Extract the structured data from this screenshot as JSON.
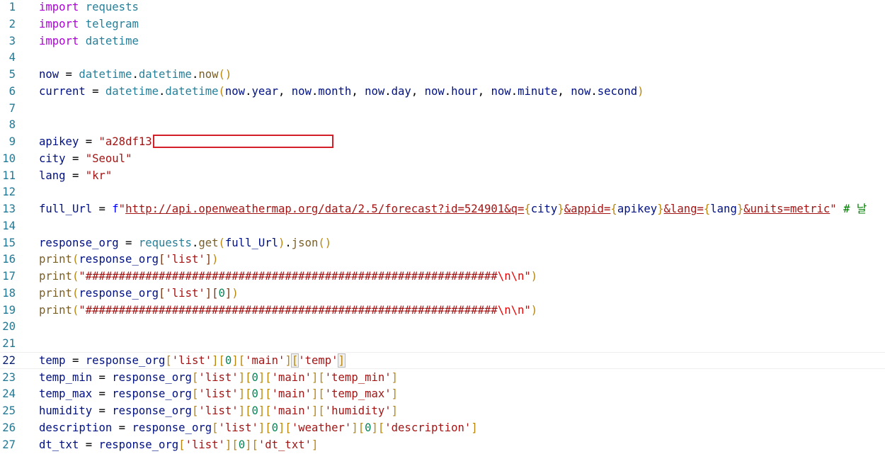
{
  "editor": {
    "current_line": 22,
    "lines": [
      {
        "n": "1",
        "tokens": [
          {
            "t": "import",
            "c": "kw"
          },
          {
            "t": " ",
            "c": "op"
          },
          {
            "t": "requests",
            "c": "mod"
          }
        ]
      },
      {
        "n": "2",
        "tokens": [
          {
            "t": "import",
            "c": "kw"
          },
          {
            "t": " ",
            "c": "op"
          },
          {
            "t": "telegram",
            "c": "mod"
          }
        ]
      },
      {
        "n": "3",
        "tokens": [
          {
            "t": "import",
            "c": "kw"
          },
          {
            "t": " ",
            "c": "op"
          },
          {
            "t": "datetime",
            "c": "mod"
          }
        ]
      },
      {
        "n": "4",
        "tokens": []
      },
      {
        "n": "5",
        "tokens": [
          {
            "t": "now",
            "c": "var"
          },
          {
            "t": " = ",
            "c": "op"
          },
          {
            "t": "datetime",
            "c": "mod"
          },
          {
            "t": ".",
            "c": "op"
          },
          {
            "t": "datetime",
            "c": "mod"
          },
          {
            "t": ".",
            "c": "op"
          },
          {
            "t": "now",
            "c": "fn"
          },
          {
            "t": "()",
            "c": "brgold"
          }
        ]
      },
      {
        "n": "6",
        "tokens": [
          {
            "t": "current",
            "c": "var"
          },
          {
            "t": " = ",
            "c": "op"
          },
          {
            "t": "datetime",
            "c": "mod"
          },
          {
            "t": ".",
            "c": "op"
          },
          {
            "t": "datetime",
            "c": "mod"
          },
          {
            "t": "(",
            "c": "brgold"
          },
          {
            "t": "now",
            "c": "var"
          },
          {
            "t": ".",
            "c": "op"
          },
          {
            "t": "year",
            "c": "var"
          },
          {
            "t": ", ",
            "c": "op"
          },
          {
            "t": "now",
            "c": "var"
          },
          {
            "t": ".",
            "c": "op"
          },
          {
            "t": "month",
            "c": "var"
          },
          {
            "t": ", ",
            "c": "op"
          },
          {
            "t": "now",
            "c": "var"
          },
          {
            "t": ".",
            "c": "op"
          },
          {
            "t": "day",
            "c": "var"
          },
          {
            "t": ", ",
            "c": "op"
          },
          {
            "t": "now",
            "c": "var"
          },
          {
            "t": ".",
            "c": "op"
          },
          {
            "t": "hour",
            "c": "var"
          },
          {
            "t": ", ",
            "c": "op"
          },
          {
            "t": "now",
            "c": "var"
          },
          {
            "t": ".",
            "c": "op"
          },
          {
            "t": "minute",
            "c": "var"
          },
          {
            "t": ", ",
            "c": "op"
          },
          {
            "t": "now",
            "c": "var"
          },
          {
            "t": ".",
            "c": "op"
          },
          {
            "t": "second",
            "c": "var"
          },
          {
            "t": ")",
            "c": "brgold"
          }
        ]
      },
      {
        "n": "7",
        "tokens": []
      },
      {
        "n": "8",
        "tokens": []
      },
      {
        "n": "9",
        "tokens": [
          {
            "t": "apikey",
            "c": "var"
          },
          {
            "t": " = ",
            "c": "op"
          },
          {
            "t": "\"a28df13",
            "c": "str"
          }
        ],
        "redacted": true
      },
      {
        "n": "10",
        "tokens": [
          {
            "t": "city",
            "c": "var"
          },
          {
            "t": " = ",
            "c": "op"
          },
          {
            "t": "\"Seoul\"",
            "c": "str"
          }
        ]
      },
      {
        "n": "11",
        "tokens": [
          {
            "t": "lang",
            "c": "var"
          },
          {
            "t": " = ",
            "c": "op"
          },
          {
            "t": "\"kr\"",
            "c": "str"
          }
        ]
      },
      {
        "n": "12",
        "tokens": []
      },
      {
        "n": "13",
        "tokens": [
          {
            "t": "full_Url",
            "c": "var"
          },
          {
            "t": " = ",
            "c": "op"
          },
          {
            "t": "f",
            "c": "brace"
          },
          {
            "t": "\"",
            "c": "str"
          },
          {
            "t": "http://api.openweathermap.org/data/2.5/forecast?id=524901&q=",
            "c": "strurl"
          },
          {
            "t": "{",
            "c": "brgold"
          },
          {
            "t": "city",
            "c": "interp"
          },
          {
            "t": "}",
            "c": "brgold"
          },
          {
            "t": "&appid=",
            "c": "strurl"
          },
          {
            "t": "{",
            "c": "brgold"
          },
          {
            "t": "apikey",
            "c": "interp"
          },
          {
            "t": "}",
            "c": "brgold"
          },
          {
            "t": "&lang=",
            "c": "strurl"
          },
          {
            "t": "{",
            "c": "brgold"
          },
          {
            "t": "lang",
            "c": "interp"
          },
          {
            "t": "}",
            "c": "brgold"
          },
          {
            "t": "&units=metric",
            "c": "strurl"
          },
          {
            "t": "\"",
            "c": "str"
          },
          {
            "t": " # 날",
            "c": "comment"
          }
        ]
      },
      {
        "n": "14",
        "tokens": []
      },
      {
        "n": "15",
        "tokens": [
          {
            "t": "response_org",
            "c": "var"
          },
          {
            "t": " = ",
            "c": "op"
          },
          {
            "t": "requests",
            "c": "mod"
          },
          {
            "t": ".",
            "c": "op"
          },
          {
            "t": "get",
            "c": "fn"
          },
          {
            "t": "(",
            "c": "brgold"
          },
          {
            "t": "full_Url",
            "c": "var"
          },
          {
            "t": ")",
            "c": "brgold"
          },
          {
            "t": ".",
            "c": "op"
          },
          {
            "t": "json",
            "c": "fn"
          },
          {
            "t": "()",
            "c": "brgold"
          }
        ]
      },
      {
        "n": "16",
        "tokens": [
          {
            "t": "print",
            "c": "fn"
          },
          {
            "t": "(",
            "c": "brgold"
          },
          {
            "t": "response_org",
            "c": "var"
          },
          {
            "t": "[",
            "c": "br3"
          },
          {
            "t": "'list'",
            "c": "str"
          },
          {
            "t": "]",
            "c": "br3"
          },
          {
            "t": ")",
            "c": "brgold"
          }
        ]
      },
      {
        "n": "17",
        "tokens": [
          {
            "t": "print",
            "c": "fn"
          },
          {
            "t": "(",
            "c": "brgold"
          },
          {
            "t": "\"##############################################################",
            "c": "str"
          },
          {
            "t": "\\n\\n",
            "c": "esc"
          },
          {
            "t": "\"",
            "c": "str"
          },
          {
            "t": ")",
            "c": "brgold"
          }
        ]
      },
      {
        "n": "18",
        "tokens": [
          {
            "t": "print",
            "c": "fn"
          },
          {
            "t": "(",
            "c": "brgold"
          },
          {
            "t": "response_org",
            "c": "var"
          },
          {
            "t": "[",
            "c": "br3"
          },
          {
            "t": "'list'",
            "c": "str"
          },
          {
            "t": "]",
            "c": "br3"
          },
          {
            "t": "[",
            "c": "br3"
          },
          {
            "t": "0",
            "c": "num"
          },
          {
            "t": "]",
            "c": "br3"
          },
          {
            "t": ")",
            "c": "brgold"
          }
        ]
      },
      {
        "n": "19",
        "tokens": [
          {
            "t": "print",
            "c": "fn"
          },
          {
            "t": "(",
            "c": "brgold"
          },
          {
            "t": "\"##############################################################",
            "c": "str"
          },
          {
            "t": "\\n\\n",
            "c": "esc"
          },
          {
            "t": "\"",
            "c": "str"
          },
          {
            "t": ")",
            "c": "brgold"
          }
        ]
      },
      {
        "n": "20",
        "tokens": []
      },
      {
        "n": "21",
        "tokens": []
      },
      {
        "n": "22",
        "tokens": [
          {
            "t": "temp",
            "c": "var"
          },
          {
            "t": " = ",
            "c": "op"
          },
          {
            "t": "response_org",
            "c": "var"
          },
          {
            "t": "[",
            "c": "brgold"
          },
          {
            "t": "'list'",
            "c": "str"
          },
          {
            "t": "]",
            "c": "brgold"
          },
          {
            "t": "[",
            "c": "brgold"
          },
          {
            "t": "0",
            "c": "num"
          },
          {
            "t": "]",
            "c": "brgold"
          },
          {
            "t": "[",
            "c": "brgold"
          },
          {
            "t": "'main'",
            "c": "str"
          },
          {
            "t": "]",
            "c": "brgold"
          },
          {
            "t": "[",
            "c": "match"
          },
          {
            "t": "'temp'",
            "c": "str"
          },
          {
            "t": "]",
            "c": "match"
          }
        ]
      },
      {
        "n": "23",
        "tokens": [
          {
            "t": "temp_min",
            "c": "var"
          },
          {
            "t": " = ",
            "c": "op"
          },
          {
            "t": "response_org",
            "c": "var"
          },
          {
            "t": "[",
            "c": "brgold"
          },
          {
            "t": "'list'",
            "c": "str"
          },
          {
            "t": "]",
            "c": "brgold"
          },
          {
            "t": "[",
            "c": "brgold"
          },
          {
            "t": "0",
            "c": "num"
          },
          {
            "t": "]",
            "c": "brgold"
          },
          {
            "t": "[",
            "c": "brgold"
          },
          {
            "t": "'main'",
            "c": "str"
          },
          {
            "t": "]",
            "c": "brgold"
          },
          {
            "t": "[",
            "c": "brgold"
          },
          {
            "t": "'temp_min'",
            "c": "str"
          },
          {
            "t": "]",
            "c": "brgold"
          }
        ]
      },
      {
        "n": "24",
        "tokens": [
          {
            "t": "temp_max",
            "c": "var"
          },
          {
            "t": " = ",
            "c": "op"
          },
          {
            "t": "response_org",
            "c": "var"
          },
          {
            "t": "[",
            "c": "brgold"
          },
          {
            "t": "'list'",
            "c": "str"
          },
          {
            "t": "]",
            "c": "brgold"
          },
          {
            "t": "[",
            "c": "brgold"
          },
          {
            "t": "0",
            "c": "num"
          },
          {
            "t": "]",
            "c": "brgold"
          },
          {
            "t": "[",
            "c": "brgold"
          },
          {
            "t": "'main'",
            "c": "str"
          },
          {
            "t": "]",
            "c": "brgold"
          },
          {
            "t": "[",
            "c": "brgold"
          },
          {
            "t": "'temp_max'",
            "c": "str"
          },
          {
            "t": "]",
            "c": "brgold"
          }
        ]
      },
      {
        "n": "25",
        "tokens": [
          {
            "t": "humidity",
            "c": "var"
          },
          {
            "t": " = ",
            "c": "op"
          },
          {
            "t": "response_org",
            "c": "var"
          },
          {
            "t": "[",
            "c": "brgold"
          },
          {
            "t": "'list'",
            "c": "str"
          },
          {
            "t": "]",
            "c": "brgold"
          },
          {
            "t": "[",
            "c": "brgold"
          },
          {
            "t": "0",
            "c": "num"
          },
          {
            "t": "]",
            "c": "brgold"
          },
          {
            "t": "[",
            "c": "brgold"
          },
          {
            "t": "'main'",
            "c": "str"
          },
          {
            "t": "]",
            "c": "brgold"
          },
          {
            "t": "[",
            "c": "brgold"
          },
          {
            "t": "'humidity'",
            "c": "str"
          },
          {
            "t": "]",
            "c": "brgold"
          }
        ]
      },
      {
        "n": "26",
        "tokens": [
          {
            "t": "description",
            "c": "var"
          },
          {
            "t": " = ",
            "c": "op"
          },
          {
            "t": "response_org",
            "c": "var"
          },
          {
            "t": "[",
            "c": "brgold"
          },
          {
            "t": "'list'",
            "c": "str"
          },
          {
            "t": "]",
            "c": "brgold"
          },
          {
            "t": "[",
            "c": "brgold"
          },
          {
            "t": "0",
            "c": "num"
          },
          {
            "t": "]",
            "c": "brgold"
          },
          {
            "t": "[",
            "c": "brgold"
          },
          {
            "t": "'weather'",
            "c": "str"
          },
          {
            "t": "]",
            "c": "brgold"
          },
          {
            "t": "[",
            "c": "brgold"
          },
          {
            "t": "0",
            "c": "num"
          },
          {
            "t": "]",
            "c": "brgold"
          },
          {
            "t": "[",
            "c": "brgold"
          },
          {
            "t": "'description'",
            "c": "str"
          },
          {
            "t": "]",
            "c": "brgold"
          }
        ]
      },
      {
        "n": "27",
        "tokens": [
          {
            "t": "dt_txt",
            "c": "var"
          },
          {
            "t": " = ",
            "c": "op"
          },
          {
            "t": "response_org",
            "c": "var"
          },
          {
            "t": "[",
            "c": "brgold"
          },
          {
            "t": "'list'",
            "c": "str"
          },
          {
            "t": "]",
            "c": "brgold"
          },
          {
            "t": "[",
            "c": "brgold"
          },
          {
            "t": "0",
            "c": "num"
          },
          {
            "t": "]",
            "c": "brgold"
          },
          {
            "t": "[",
            "c": "brgold"
          },
          {
            "t": "'dt_txt'",
            "c": "str"
          },
          {
            "t": "]",
            "c": "brgold"
          }
        ]
      }
    ]
  },
  "colors": {
    "line_number": "#237893",
    "keyword": "#af00db",
    "module": "#267f99",
    "variable": "#001080",
    "function": "#795e26",
    "string": "#a31515",
    "redaction_border": "#d32028"
  }
}
